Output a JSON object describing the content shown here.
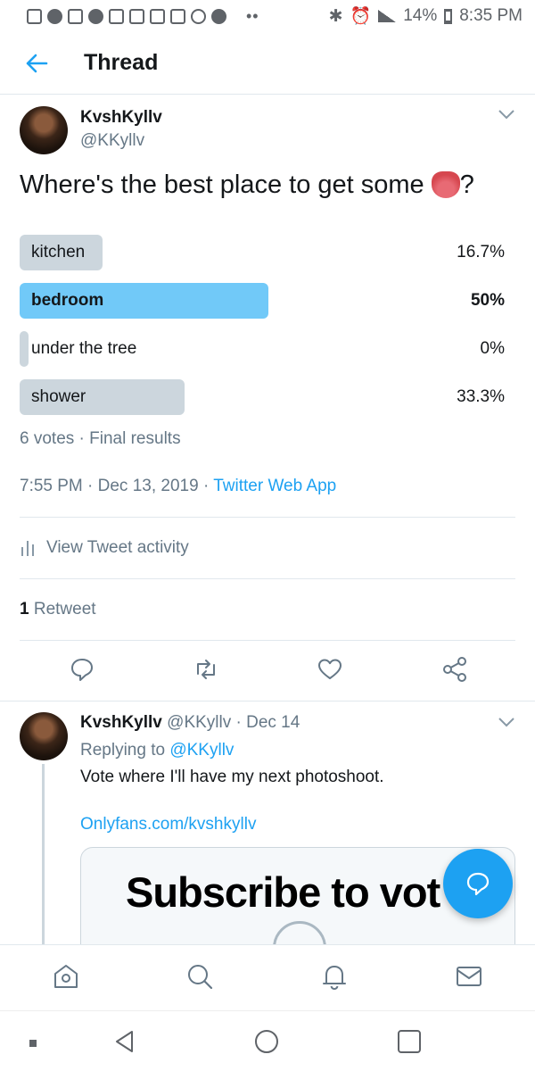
{
  "status_bar": {
    "battery": "14%",
    "time": "8:35 PM"
  },
  "header": {
    "title": "Thread"
  },
  "tweet": {
    "author_name": "KvshKyllv",
    "author_handle": "@KKyllv",
    "text": "Where's the best place to get some",
    "text_suffix": "?",
    "emoji": "tongue",
    "poll": {
      "options": [
        {
          "label": "kitchen",
          "percent": "16.7%",
          "value": 16.7
        },
        {
          "label": "bedroom",
          "percent": "50%",
          "value": 50,
          "winner": true
        },
        {
          "label": "under the tree",
          "percent": "0%",
          "value": 0
        },
        {
          "label": "shower",
          "percent": "33.3%",
          "value": 33.3
        }
      ],
      "summary": "6 votes · Final results"
    },
    "timestamp": "7:55 PM · Dec 13, 2019 · ",
    "source": "Twitter Web App",
    "activity_label": "View Tweet activity",
    "retweet_count": "1",
    "retweet_label": "Retweet"
  },
  "reply": {
    "author_name": "KvshKyllv",
    "author_handle_date": "@KKyllv · Dec 14",
    "replying_prefix": "Replying to ",
    "replying_to": "@KKyllv",
    "text": "Vote where I'll have my next photoshoot.",
    "link": "Onlyfans.com/kvshkyllv",
    "card_text": "Subscribe to vot"
  },
  "colors": {
    "accent": "#1da1f2",
    "winner_bar": "#71c9f8",
    "bar": "#ccd6dd",
    "muted": "#657786"
  }
}
